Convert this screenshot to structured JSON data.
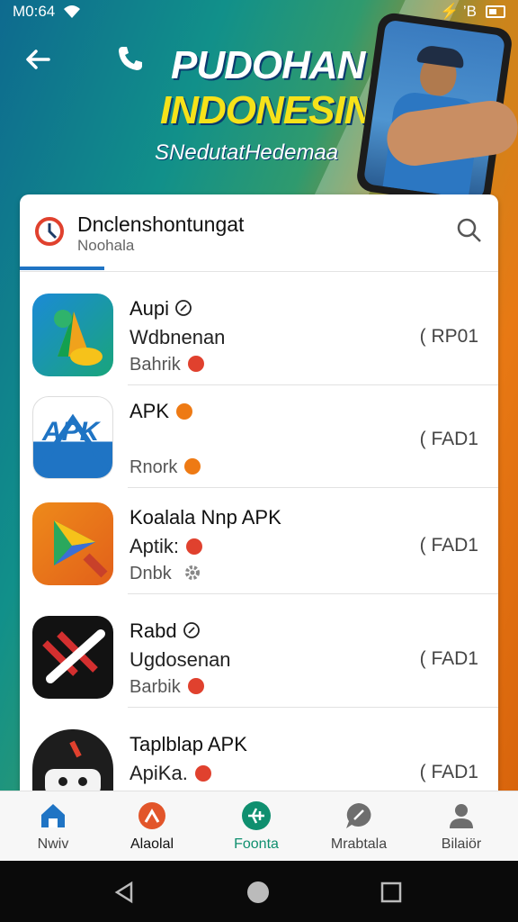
{
  "status_bar": {
    "time": "M0:64",
    "right": "⚡ ’B"
  },
  "banner": {
    "line1": "PUDOHAN",
    "line2": "INDONESIN",
    "line3": "SNedutatHedemaa"
  },
  "search": {
    "title": "Dnclenshontungat",
    "subtitle": "Noohala"
  },
  "apps": [
    {
      "name": "Aupi",
      "line2": "Wdbnenan",
      "line3": "Bahrik",
      "tag": "( RP01"
    },
    {
      "name": "APK",
      "line2": "",
      "line3": "Rnork",
      "tag": "( FAD1"
    },
    {
      "name": "Koalala Nnp APK",
      "line2": "Aptik:",
      "line3": "Dnbk",
      "tag": "( FAD1"
    },
    {
      "name": "Rabd",
      "line2": "Ugdosenan",
      "line3": "Barbik",
      "tag": "( FAD1"
    },
    {
      "name": "Taplblap APK",
      "line2": "ApiKa.",
      "line3": "",
      "tag": "( FAD1"
    }
  ],
  "apk_icon_text": "APK",
  "bottom_nav": [
    {
      "label": "Nwiv",
      "icon": "home-icon"
    },
    {
      "label": "Alaolal",
      "icon": "pin-icon"
    },
    {
      "label": "Foonta",
      "icon": "plane-icon"
    },
    {
      "label": "Mrabtala",
      "icon": "chat-icon"
    },
    {
      "label": "Bilaiör",
      "icon": "profile-icon"
    }
  ],
  "colors": {
    "accent": "#1f74c4",
    "active_nav": "#0f8f6f",
    "badge_red": "#e0412e"
  }
}
